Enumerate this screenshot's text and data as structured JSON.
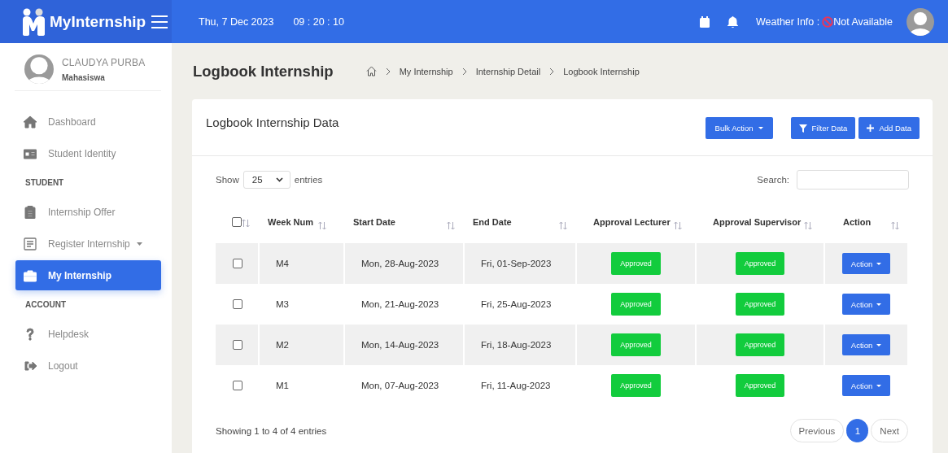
{
  "topbar": {
    "brand": "MyInternship",
    "date": "Thu, 7 Dec 2023",
    "time": "09 : 20 : 10",
    "weather_label": "Weather Info :",
    "weather_value": "Not Available"
  },
  "profile": {
    "name": "CLAUDYA PURBA",
    "role": "Mahasiswa"
  },
  "sidebar": {
    "items": [
      {
        "kind": "item",
        "label": "Dashboard",
        "selected": false
      },
      {
        "kind": "item",
        "label": "Student Identity",
        "selected": false
      },
      {
        "kind": "header",
        "label": "STUDENT"
      },
      {
        "kind": "item",
        "label": "Internship Offer",
        "selected": false
      },
      {
        "kind": "item",
        "label": "Register Internship",
        "selected": false,
        "dropdown": true
      },
      {
        "kind": "item",
        "label": "My Internship",
        "selected": true
      },
      {
        "kind": "header",
        "label": "ACCOUNT"
      },
      {
        "kind": "item",
        "label": "Helpdesk",
        "selected": false
      },
      {
        "kind": "item",
        "label": "Logout",
        "selected": false
      }
    ]
  },
  "page": {
    "title": "Logbook Internship",
    "breadcrumb": [
      "My Internship",
      "Internship Detail",
      "Logbook Internship"
    ]
  },
  "card": {
    "title": "Logbook Internship Data",
    "buttons": [
      {
        "kind": "dropdown",
        "label": "Bulk Action"
      },
      {
        "kind": "filter",
        "label": "Filter Data"
      },
      {
        "kind": "add",
        "label": "Add Data"
      }
    ]
  },
  "table": {
    "show_label": "Show",
    "page_size": "25",
    "entries_label": "entries",
    "search_label": "Search:",
    "select_all_checked": false,
    "columns": [
      "Week Num",
      "Start Date",
      "End Date",
      "Approval Lecturer",
      "Approval Supervisor",
      "Action"
    ],
    "rows": [
      {
        "checked": false,
        "week": "M4",
        "start": "Mon, 28-Aug-2023",
        "end": "Fri, 01-Sep-2023",
        "lecturer": "Approved",
        "supervisor": "Approved",
        "action": "Action"
      },
      {
        "checked": false,
        "week": "M3",
        "start": "Mon, 21-Aug-2023",
        "end": "Fri, 25-Aug-2023",
        "lecturer": "Approved",
        "supervisor": "Approved",
        "action": "Action"
      },
      {
        "checked": false,
        "week": "M2",
        "start": "Mon, 14-Aug-2023",
        "end": "Fri, 18-Aug-2023",
        "lecturer": "Approved",
        "supervisor": "Approved",
        "action": "Action"
      },
      {
        "checked": false,
        "week": "M1",
        "start": "Mon, 07-Aug-2023",
        "end": "Fri, 11-Aug-2023",
        "lecturer": "Approved",
        "supervisor": "Approved",
        "action": "Action"
      }
    ],
    "info": "Showing 1 to 4 of 4 entries",
    "pagination": [
      {
        "label": "Previous",
        "selected": false
      },
      {
        "label": "1",
        "selected": true
      },
      {
        "label": "Next",
        "selected": false
      }
    ]
  }
}
